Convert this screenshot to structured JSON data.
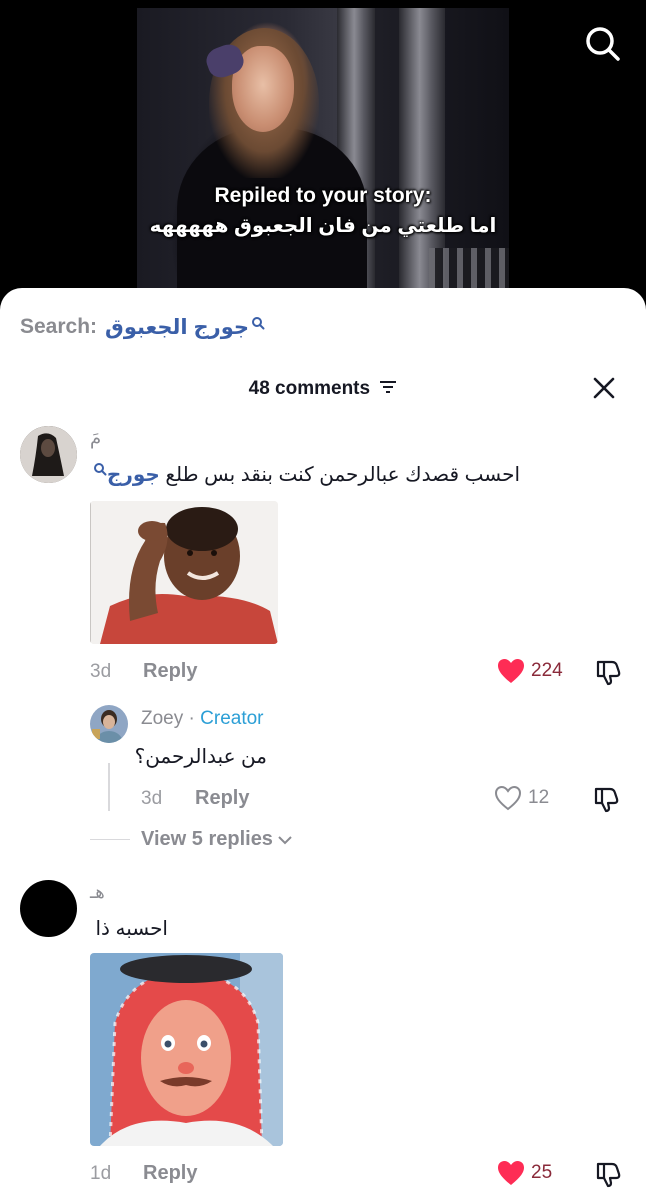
{
  "video": {
    "caption_line1": "Repiled to your story:",
    "caption_line2": "اما طلعتي من فان الجعبوق هههههه"
  },
  "top_search_icon": "search-icon",
  "search_bar": {
    "label": "Search:",
    "term": "جورج الجعبوق"
  },
  "comments_header": {
    "count_label": "48 comments",
    "close_icon": "close-icon",
    "filter_icon": "filter-icon"
  },
  "comments": [
    {
      "username": "مَ",
      "text_mention": "جورج",
      "text_rest": "احسب قصدك عبالرحمن كنت بنقد بس طلع ",
      "time": "3d",
      "reply_label": "Reply",
      "likes": "224",
      "liked": true,
      "replies": [
        {
          "username": "Zoey",
          "separator": "·",
          "role": "Creator",
          "text": "من عبدالرحمن؟",
          "time": "3d",
          "reply_label": "Reply",
          "likes": "12",
          "liked": false
        }
      ],
      "view_replies_label": "View 5 replies"
    },
    {
      "username": "هـ",
      "text": "احسبه ذا",
      "time": "1d",
      "reply_label": "Reply",
      "likes": "25",
      "liked": true
    }
  ],
  "colors": {
    "like_active": "#fe2c55",
    "mention": "#3a5fa8",
    "creator": "#2c9fd6"
  }
}
